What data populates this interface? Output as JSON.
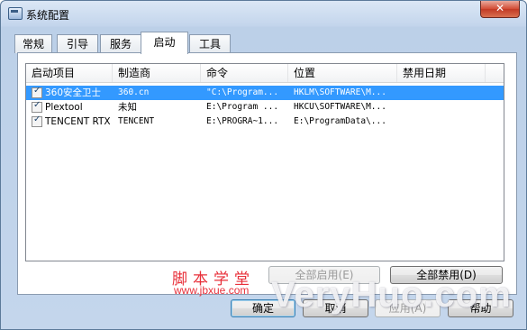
{
  "window": {
    "title": "系统配置",
    "close_glyph": "✕"
  },
  "tabs": [
    {
      "label": "常规"
    },
    {
      "label": "引导"
    },
    {
      "label": "服务"
    },
    {
      "label": "启动",
      "active": true
    },
    {
      "label": "工具"
    }
  ],
  "startup_list": {
    "columns": [
      "启动项目",
      "制造商",
      "命令",
      "位置",
      "禁用日期"
    ],
    "rows": [
      {
        "name": "360安全卫士",
        "maker": "360.cn",
        "command": "\"C:\\Program...",
        "location": "HKLM\\SOFTWARE\\M...",
        "disabled_date": "",
        "checked": true,
        "selected": true
      },
      {
        "name": "Plextool",
        "maker": "未知",
        "command": "E:\\Program ...",
        "location": "HKCU\\SOFTWARE\\M...",
        "disabled_date": "",
        "checked": true,
        "selected": false
      },
      {
        "name": "TENCENT RTX",
        "maker": "TENCENT",
        "command": "E:\\PROGRA~1...",
        "location": "E:\\ProgramData\\...",
        "disabled_date": "",
        "checked": true,
        "selected": false
      }
    ]
  },
  "buttons": {
    "enable_all": "全部启用(E)",
    "disable_all": "全部禁用(D)",
    "ok": "确定",
    "cancel": "取消",
    "apply": "应用(A)",
    "help": "帮助"
  },
  "watermarks": {
    "site_cn": "脚本学堂",
    "site_url": "www.jbxue.com",
    "brand": "VeryHuo.com"
  },
  "colors": {
    "selection": "#3399ff",
    "close_button": "#c23a24",
    "watermark_red": "#e8303a"
  }
}
